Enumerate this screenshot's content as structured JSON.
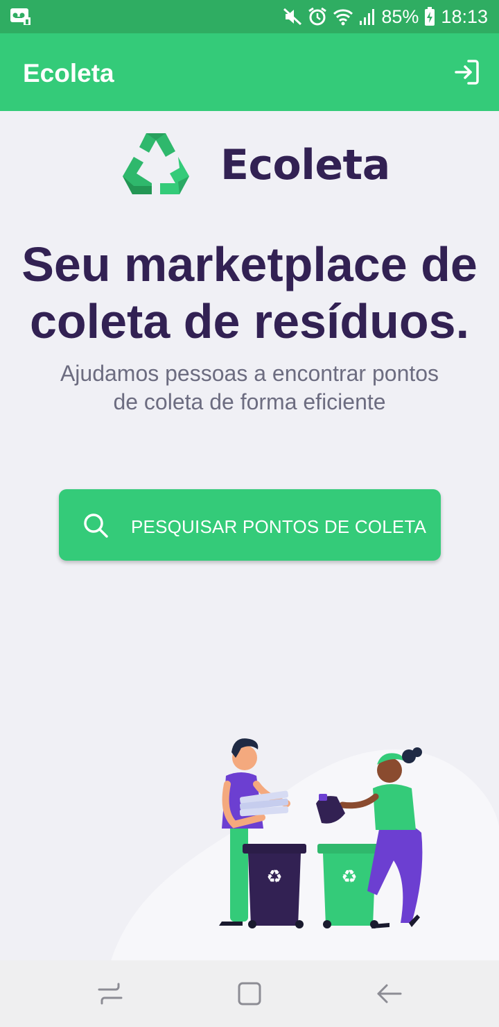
{
  "status_bar": {
    "battery": "85%",
    "time": "18:13",
    "icons": [
      "voicemail-icon",
      "mute-icon",
      "alarm-icon",
      "wifi-icon",
      "signal-icon",
      "battery-charging-icon"
    ]
  },
  "app_bar": {
    "title": "Ecoleta",
    "action_icon": "login-icon"
  },
  "logo": {
    "icon": "recycle-icon",
    "text": "Ecoleta"
  },
  "hero": {
    "title_line1": "Seu marketplace de",
    "title_line2": "coleta de resíduos.",
    "subtitle_line1": "Ajudamos pessoas a encontrar pontos",
    "subtitle_line2": "de coleta de forma eficiente"
  },
  "search_button": {
    "icon": "search-icon",
    "label": "PESQUISAR PONTOS DE COLETA"
  },
  "nav_bar": {
    "items": [
      "recents-icon",
      "home-icon",
      "back-icon"
    ]
  },
  "colors": {
    "primary_green": "#34cb79",
    "status_green": "#2fad62",
    "dark_purple": "#322153",
    "gray_text": "#6c6c80",
    "background": "#f0f0f5"
  }
}
